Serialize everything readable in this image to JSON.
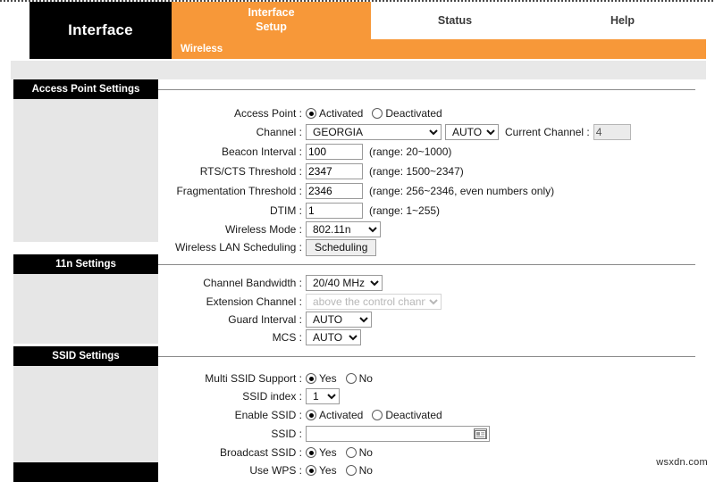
{
  "colors": {
    "accent_orange": "#f79839",
    "bar_black": "#000000",
    "rail_grey": "#e6e6e6",
    "band_grey": "#e8e8e8"
  },
  "header": {
    "brand": "Interface",
    "tabs": [
      {
        "label": "Interface Setup",
        "line1": "Interface",
        "line2": "Setup",
        "active": true
      },
      {
        "label": "Status",
        "active": false
      },
      {
        "label": "Help",
        "active": false
      }
    ],
    "subnav": "Wireless"
  },
  "sections": [
    {
      "id": "access-point-settings",
      "title": "Access Point Settings",
      "rows": [
        {
          "label": "Access Point :",
          "type": "radio",
          "options": [
            "Activated",
            "Deactivated"
          ],
          "selected": "Activated"
        },
        {
          "label": "Channel :",
          "type": "channel",
          "region_value": "GEORGIA",
          "auto_value": "AUTO",
          "current_channel_label": "Current Channel :",
          "current_channel_value": "4"
        },
        {
          "label": "Beacon Interval :",
          "type": "text",
          "value": "100",
          "hint": "(range: 20~1000)"
        },
        {
          "label": "RTS/CTS Threshold :",
          "type": "text",
          "value": "2347",
          "hint": "(range: 1500~2347)"
        },
        {
          "label": "Fragmentation Threshold :",
          "type": "text",
          "value": "2346",
          "hint": "(range: 256~2346, even numbers only)"
        },
        {
          "label": "DTIM :",
          "type": "text",
          "value": "1",
          "hint": "(range: 1~255)"
        },
        {
          "label": "Wireless Mode :",
          "type": "select",
          "value": "802.11n"
        },
        {
          "label": "Wireless LAN Scheduling :",
          "type": "button",
          "value": "Scheduling"
        }
      ]
    },
    {
      "id": "11n-settings",
      "title": "11n Settings",
      "rows": [
        {
          "label": "Channel Bandwidth :",
          "type": "select",
          "value": "20/40 MHz"
        },
        {
          "label": "Extension Channel :",
          "type": "select",
          "value": "above the control channel",
          "disabled": true
        },
        {
          "label": "Guard Interval :",
          "type": "select",
          "value": "AUTO"
        },
        {
          "label": "MCS :",
          "type": "select",
          "value": "AUTO"
        }
      ]
    },
    {
      "id": "ssid-settings",
      "title": "SSID Settings",
      "rows": [
        {
          "label": "Multi SSID Support :",
          "type": "radio",
          "options": [
            "Yes",
            "No"
          ],
          "selected": "Yes"
        },
        {
          "label": "SSID index :",
          "type": "select",
          "value": "1"
        },
        {
          "label": "Enable SSID :",
          "type": "radio",
          "options": [
            "Activated",
            "Deactivated"
          ],
          "selected": "Activated"
        },
        {
          "label": "SSID :",
          "type": "ssid",
          "value": "",
          "placeholder": ""
        },
        {
          "label": "Broadcast SSID :",
          "type": "radio",
          "options": [
            "Yes",
            "No"
          ],
          "selected": "Yes"
        },
        {
          "label": "Use WPS :",
          "type": "radio",
          "options": [
            "Yes",
            "No"
          ],
          "selected": "Yes"
        }
      ]
    }
  ],
  "watermark": "wsxdn.com"
}
